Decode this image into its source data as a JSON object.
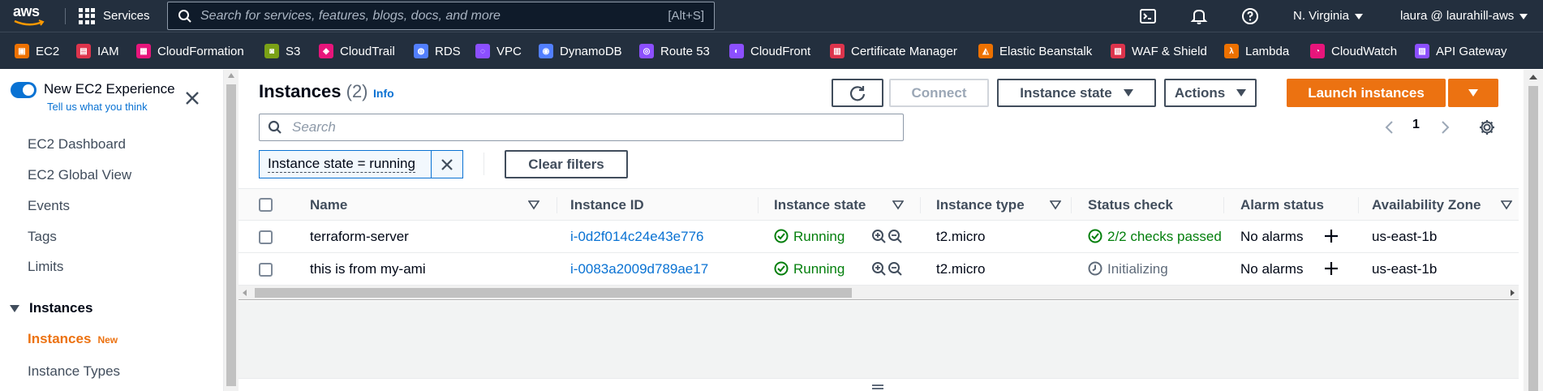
{
  "topnav": {
    "logo_text": "aws",
    "services_label": "Services",
    "search_placeholder": "Search for services, features, blogs, docs, and more",
    "search_shortcut": "[Alt+S]",
    "region": "N. Virginia",
    "account": "laura @ laurahill-aws",
    "icons": [
      "cloudshell-icon",
      "bell-icon",
      "help-icon"
    ]
  },
  "favorites": [
    {
      "label": "EC2",
      "color": "#ed7100"
    },
    {
      "label": "IAM",
      "color": "#dd344c"
    },
    {
      "label": "CloudFormation",
      "color": "#e7157b"
    },
    {
      "label": "S3",
      "color": "#7aa116"
    },
    {
      "label": "CloudTrail",
      "color": "#e7157b"
    },
    {
      "label": "RDS",
      "color": "#527fff"
    },
    {
      "label": "VPC",
      "color": "#8c4fff"
    },
    {
      "label": "DynamoDB",
      "color": "#527fff"
    },
    {
      "label": "Route 53",
      "color": "#8c4fff"
    },
    {
      "label": "CloudFront",
      "color": "#8c4fff"
    },
    {
      "label": "Certificate Manager",
      "color": "#dd344c"
    },
    {
      "label": "Elastic Beanstalk",
      "color": "#ed7100"
    },
    {
      "label": "WAF & Shield",
      "color": "#dd344c"
    },
    {
      "label": "Lambda",
      "color": "#ed7100"
    },
    {
      "label": "CloudWatch",
      "color": "#e7157b"
    },
    {
      "label": "API Gateway",
      "color": "#8c4fff"
    }
  ],
  "sidebar": {
    "new_experience": "New EC2 Experience",
    "tell_us": "Tell us what you think",
    "items": [
      "EC2 Dashboard",
      "EC2 Global View",
      "Events",
      "Tags",
      "Limits"
    ],
    "section": "Instances",
    "active_item": "Instances",
    "active_badge": "New",
    "next_item": "Instance Types"
  },
  "main": {
    "title": "Instances",
    "count": "(2)",
    "info": "Info",
    "buttons": {
      "connect": "Connect",
      "instance_state": "Instance state",
      "actions": "Actions",
      "launch": "Launch instances"
    },
    "search_placeholder": "Search",
    "page": "1",
    "filter_token": "Instance state = running",
    "clear_filters": "Clear filters"
  },
  "table": {
    "columns": [
      "Name",
      "Instance ID",
      "Instance state",
      "Instance type",
      "Status check",
      "Alarm status",
      "Availability Zone"
    ],
    "rows": [
      {
        "name": "terraform-server",
        "id": "i-0d2f014c24e43e776",
        "state": "Running",
        "type": "t2.micro",
        "status": "2/2 checks passed",
        "alarm": "No alarms",
        "az": "us-east-1b"
      },
      {
        "name": "this is from my-ami",
        "id": "i-0083a2009d789ae17",
        "state": "Running",
        "type": "t2.micro",
        "status": "Initializing",
        "alarm": "No alarms",
        "az": "us-east-1b"
      }
    ]
  },
  "colors": {
    "nav_bg": "#232f3e",
    "primary": "#ec7211",
    "link": "#0972d3",
    "success": "#037f0c"
  }
}
